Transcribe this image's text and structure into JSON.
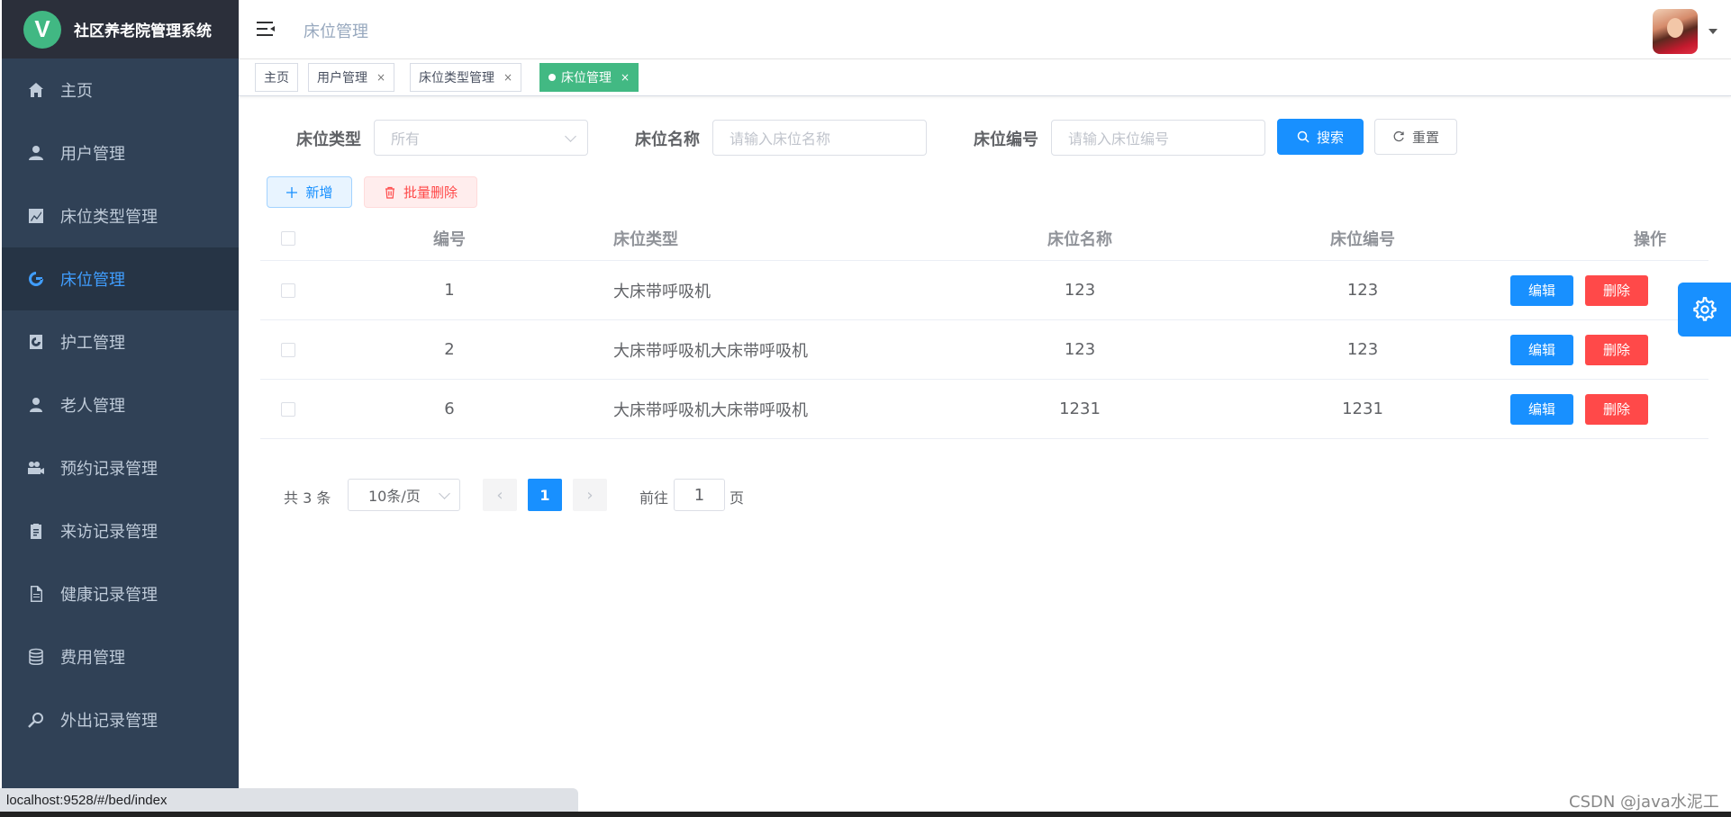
{
  "app": {
    "title": "社区养老院管理系统",
    "logo_letter": "V"
  },
  "sidebar": {
    "items": [
      {
        "label": "主页",
        "icon": "home-icon",
        "active": false
      },
      {
        "label": "用户管理",
        "icon": "user-icon",
        "active": false
      },
      {
        "label": "床位类型管理",
        "icon": "chart-icon",
        "active": false
      },
      {
        "label": "床位管理",
        "icon": "bed-icon",
        "active": true
      },
      {
        "label": "护工管理",
        "icon": "caregiver-icon",
        "active": false
      },
      {
        "label": "老人管理",
        "icon": "person-icon",
        "active": false
      },
      {
        "label": "预约记录管理",
        "icon": "camera-icon",
        "active": false
      },
      {
        "label": "来访记录管理",
        "icon": "clipboard-icon",
        "active": false
      },
      {
        "label": "健康记录管理",
        "icon": "document-icon",
        "active": false
      },
      {
        "label": "费用管理",
        "icon": "database-icon",
        "active": false
      },
      {
        "label": "外出记录管理",
        "icon": "search-key-icon",
        "active": false
      }
    ]
  },
  "navbar": {
    "breadcrumb": "床位管理"
  },
  "tags": [
    {
      "label": "主页",
      "closable": false,
      "active": false
    },
    {
      "label": "用户管理",
      "closable": true,
      "active": false
    },
    {
      "label": "床位类型管理",
      "closable": true,
      "active": false
    },
    {
      "label": "床位管理",
      "closable": true,
      "active": true
    }
  ],
  "tag_close": "×",
  "search": {
    "bed_type_label": "床位类型",
    "bed_type_value": "所有",
    "bed_name_label": "床位名称",
    "bed_name_placeholder": "请输入床位名称",
    "bed_no_label": "床位编号",
    "bed_no_placeholder": "请输入床位编号",
    "search_button": "搜索",
    "reset_button": "重置"
  },
  "toolbar": {
    "add_button": "新增",
    "batch_delete_button": "批量删除"
  },
  "table": {
    "columns": [
      "编号",
      "床位类型",
      "床位名称",
      "床位编号",
      "操作"
    ],
    "rows": [
      {
        "id": "1",
        "type": "大床带呼吸机",
        "name": "123",
        "code": "123"
      },
      {
        "id": "2",
        "type": "大床带呼吸机大床带呼吸机",
        "name": "123",
        "code": "123"
      },
      {
        "id": "6",
        "type": "大床带呼吸机大床带呼吸机",
        "name": "1231",
        "code": "1231"
      }
    ],
    "edit_label": "编辑",
    "delete_label": "删除"
  },
  "pagination": {
    "total_text": "共 3 条",
    "page_size": "10条/页",
    "current_page": "1",
    "goto_prefix": "前往",
    "goto_value": "1",
    "goto_suffix": "页"
  },
  "statusbar": {
    "url": "localhost:9528/#/bed/index"
  },
  "watermark": "CSDN @java水泥工",
  "colors": {
    "sidebar_bg": "#304156",
    "primary": "#1890ff",
    "danger": "#ff4949",
    "tag_active": "#42b983"
  }
}
